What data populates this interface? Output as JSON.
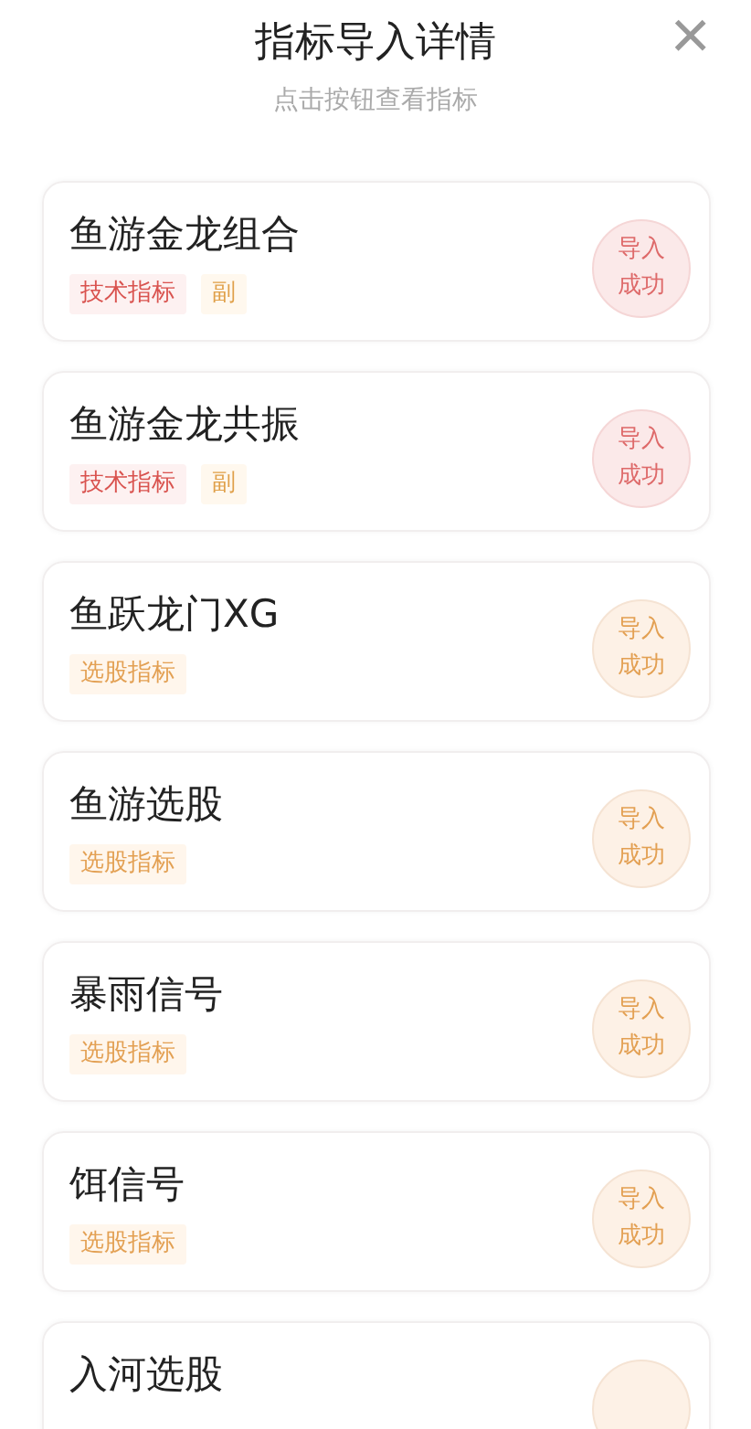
{
  "header": {
    "title": "指标导入详情",
    "subtitle": "点击按钮查看指标",
    "close": "×"
  },
  "items": [
    {
      "name": "鱼游金龙组合",
      "tags": [
        {
          "text": "技术指标",
          "kind": "tech"
        },
        {
          "text": "副",
          "kind": "sub"
        }
      ],
      "status": {
        "kind": "tech",
        "lines": [
          "导入",
          "成功"
        ]
      }
    },
    {
      "name": "鱼游金龙共振",
      "tags": [
        {
          "text": "技术指标",
          "kind": "tech"
        },
        {
          "text": "副",
          "kind": "sub"
        }
      ],
      "status": {
        "kind": "tech",
        "lines": [
          "导入",
          "成功"
        ]
      }
    },
    {
      "name": "鱼跃龙门XG",
      "tags": [
        {
          "text": "选股指标",
          "kind": "select"
        }
      ],
      "status": {
        "kind": "select",
        "lines": [
          "导入",
          "成功"
        ]
      }
    },
    {
      "name": "鱼游选股",
      "tags": [
        {
          "text": "选股指标",
          "kind": "select"
        }
      ],
      "status": {
        "kind": "select",
        "lines": [
          "导入",
          "成功"
        ]
      }
    },
    {
      "name": "暴雨信号",
      "tags": [
        {
          "text": "选股指标",
          "kind": "select"
        }
      ],
      "status": {
        "kind": "select",
        "lines": [
          "导入",
          "成功"
        ]
      }
    },
    {
      "name": "饵信号",
      "tags": [
        {
          "text": "选股指标",
          "kind": "select"
        }
      ],
      "status": {
        "kind": "select",
        "lines": [
          "导入",
          "成功"
        ]
      }
    },
    {
      "name": "入河选股",
      "status": {
        "kind": "select"
      }
    }
  ]
}
